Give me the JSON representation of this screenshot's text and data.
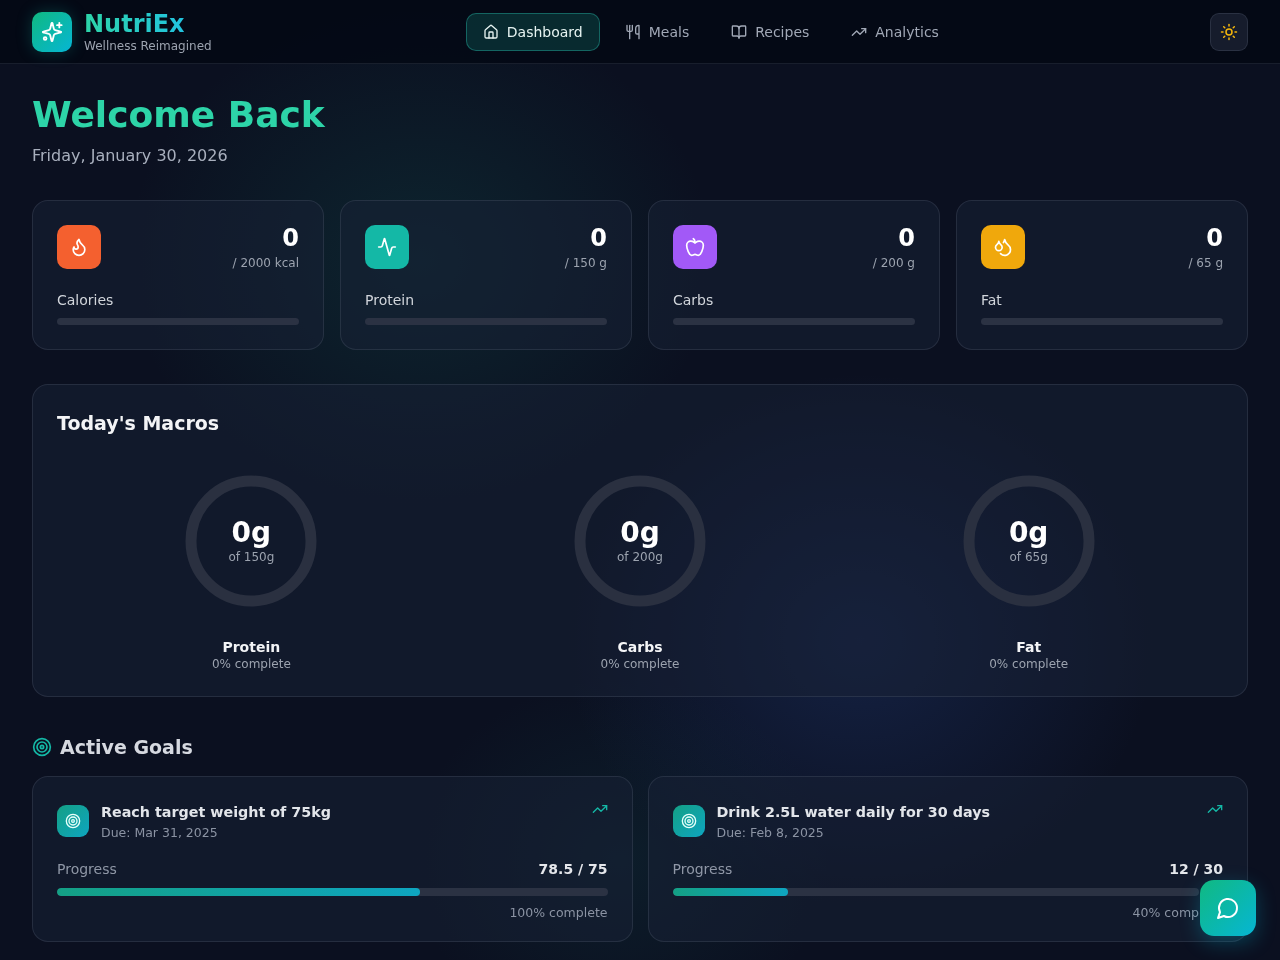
{
  "header": {
    "brand": {
      "name": "NutriEx",
      "tagline": "Wellness Reimagined"
    },
    "nav": [
      {
        "label": "Dashboard",
        "selected": true
      },
      {
        "label": "Meals",
        "selected": false
      },
      {
        "label": "Recipes",
        "selected": false
      },
      {
        "label": "Analytics",
        "selected": false
      }
    ]
  },
  "welcome": {
    "title": "Welcome Back",
    "date": "Friday, January 30, 2026"
  },
  "stats": [
    {
      "label": "Calories",
      "value": "0",
      "target": "/ 2000 kcal",
      "color": "#f4602f"
    },
    {
      "label": "Protein",
      "value": "0",
      "target": "/ 150 g",
      "color": "#14b8a6"
    },
    {
      "label": "Carbs",
      "value": "0",
      "target": "/ 200 g",
      "color": "#a259f7"
    },
    {
      "label": "Fat",
      "value": "0",
      "target": "/ 65 g",
      "color": "#f0a80c"
    }
  ],
  "macros": {
    "title": "Today's Macros",
    "rings": [
      {
        "value": "0g",
        "target": "of 150g",
        "label": "Protein",
        "note": "0% complete"
      },
      {
        "value": "0g",
        "target": "of 200g",
        "label": "Carbs",
        "note": "0% complete"
      },
      {
        "value": "0g",
        "target": "of 65g",
        "label": "Fat",
        "note": "0% complete"
      }
    ]
  },
  "goals": {
    "title": "Active Goals",
    "items": [
      {
        "title": "Reach target weight of 75kg",
        "due": "Due: Mar 31, 2025",
        "progress_label": "Progress",
        "progress": "78.5 / 75",
        "level": 0.66,
        "note": "100% complete"
      },
      {
        "title": "Drink 2.5L water daily for 30 days",
        "due": "Due: Feb 8, 2025",
        "progress_label": "Progress",
        "progress": "12 / 30",
        "level": 0.22,
        "note": "40% comp"
      }
    ]
  }
}
